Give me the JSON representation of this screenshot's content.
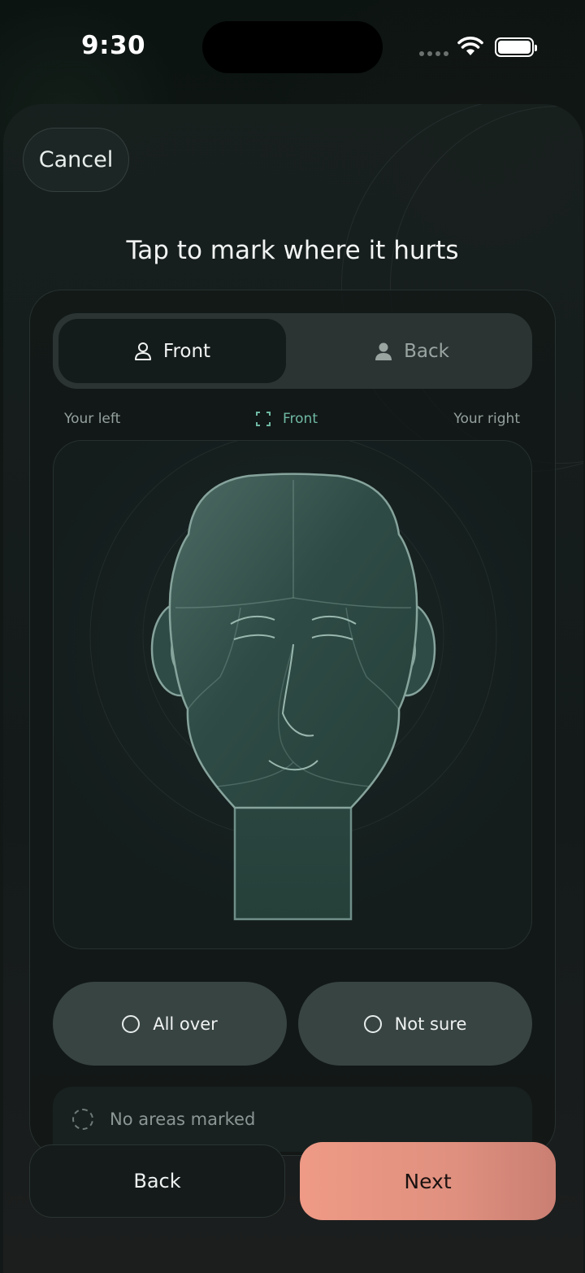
{
  "status_bar": {
    "time": "9:30"
  },
  "header": {
    "cancel_label": "Cancel",
    "title": "Tap to mark where it hurts"
  },
  "view_toggle": {
    "front_label": "Front",
    "back_label": "Back",
    "selected": "Front"
  },
  "orientation": {
    "left_label": "Your left",
    "center_label": "Front",
    "right_label": "Your right"
  },
  "options": {
    "all_over_label": "All over",
    "not_sure_label": "Not sure"
  },
  "marked_status": "No areas marked",
  "footer": {
    "back_label": "Back",
    "next_label": "Next"
  },
  "colors": {
    "accent": "#6fb8a4",
    "next_button": "#ee9a86",
    "head_fill": "#2c4a44"
  }
}
